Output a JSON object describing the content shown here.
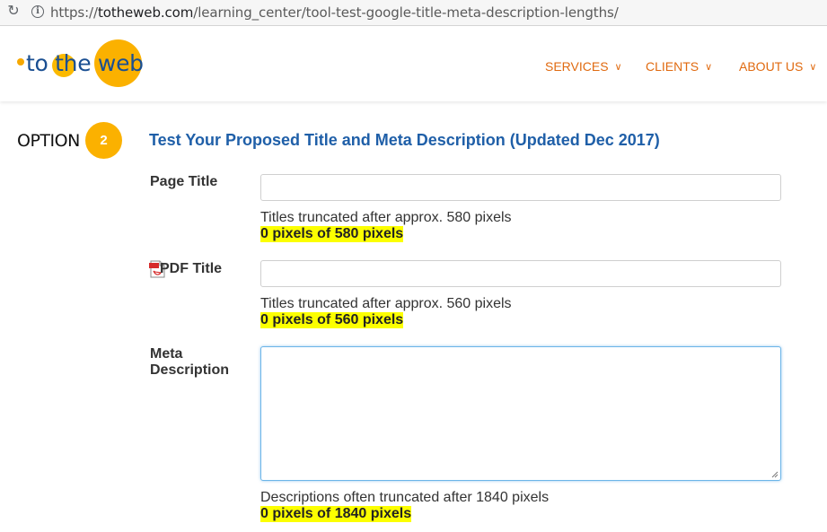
{
  "browser": {
    "url_prefix": "https://",
    "url_domain": "totheweb.com",
    "url_path": "/learning_center/tool-test-google-title-meta-description-lengths/"
  },
  "header": {
    "logo_text": "to the web",
    "nav": [
      {
        "label": "SERVICES"
      },
      {
        "label": "CLIENTS"
      },
      {
        "label": "ABOUT US"
      }
    ],
    "accent_color": "#e06a10",
    "logo_color": "#fbb100"
  },
  "main": {
    "option_label": "OPTION",
    "option_number": "2",
    "title": "Test Your Proposed Title and Meta Description (Updated Dec 2017)",
    "fields": {
      "page_title": {
        "label": "Page Title",
        "value": "",
        "hint": "Titles truncated after approx. 580 pixels",
        "count": "0 pixels of 580 pixels"
      },
      "pdf_title": {
        "label": "PDF Title",
        "icon": "pdf-icon",
        "value": "",
        "hint": "Titles truncated after approx. 560 pixels",
        "count": "0 pixels of 560 pixels"
      },
      "meta_description": {
        "label_line1": "Meta",
        "label_line2": "Description",
        "value": "",
        "hint": "Descriptions often truncated after 1840 pixels",
        "count": "0 pixels of 1840 pixels"
      }
    }
  }
}
